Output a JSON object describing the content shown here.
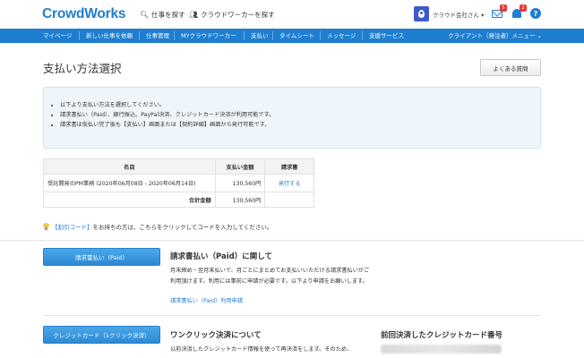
{
  "header": {
    "logo": "CrowdWorks",
    "find_jobs": "仕事を探す",
    "find_workers": "クラウドワーカーを探す",
    "user_name": "クラウド会社さん ▾",
    "mail_badge": "5",
    "bell_badge": "2",
    "help": "?"
  },
  "nav": {
    "items": [
      "マイページ",
      "新しい仕事を依頼",
      "仕事管理",
      "MYクラウドワーカー",
      "支払い",
      "タイムシート",
      "メッセージ",
      "支援サービス"
    ],
    "right": "クライアント（発注者）メニュー"
  },
  "page": {
    "title": "支払い方法選択",
    "faq_button": "よくある質問"
  },
  "info": {
    "lines": [
      "以下より支払い方法を選択してください。",
      "請求書払い（Paid）、銀行振込、PayPal決済、クレジットカード決済が利用可能です。",
      "請求書は仮払い完了後も【支払い】画面または【契約詳細】画面から発行可能です。"
    ]
  },
  "table": {
    "headers": [
      "名目",
      "支払い金額",
      "請求書"
    ],
    "row": {
      "item": "受託開発のPM業務 (2020年06月08日 - 2020年06月14日)",
      "amount": "130,560円",
      "invoice": "発行する"
    },
    "total_label": "合計金額",
    "total_amount": "130,560円"
  },
  "coupon": {
    "highlight": "【割引コード】",
    "text": "をお持ちの方は、こちらをクリックしてコードを入力してください。"
  },
  "paid_section": {
    "button": "請求書払い（Paid）",
    "title": "請求書払い（Paid）に関して",
    "desc": "月末締め・翌月末払いで、月ごとにまとめてお支払いいただける請求書払いがご利用頂けます。利用には事前に申請が必要です。以下より申請をお願いします。",
    "link": "請求書払い（Paid）利用申請"
  },
  "card_section": {
    "button": "クレジットカード（1クリック決済）",
    "title": "ワンクリック決済について",
    "desc": "以前決済したクレジットカード情報を使って再決済をします。そのため、",
    "prev_title": "前回決済したクレジットカード番号"
  }
}
